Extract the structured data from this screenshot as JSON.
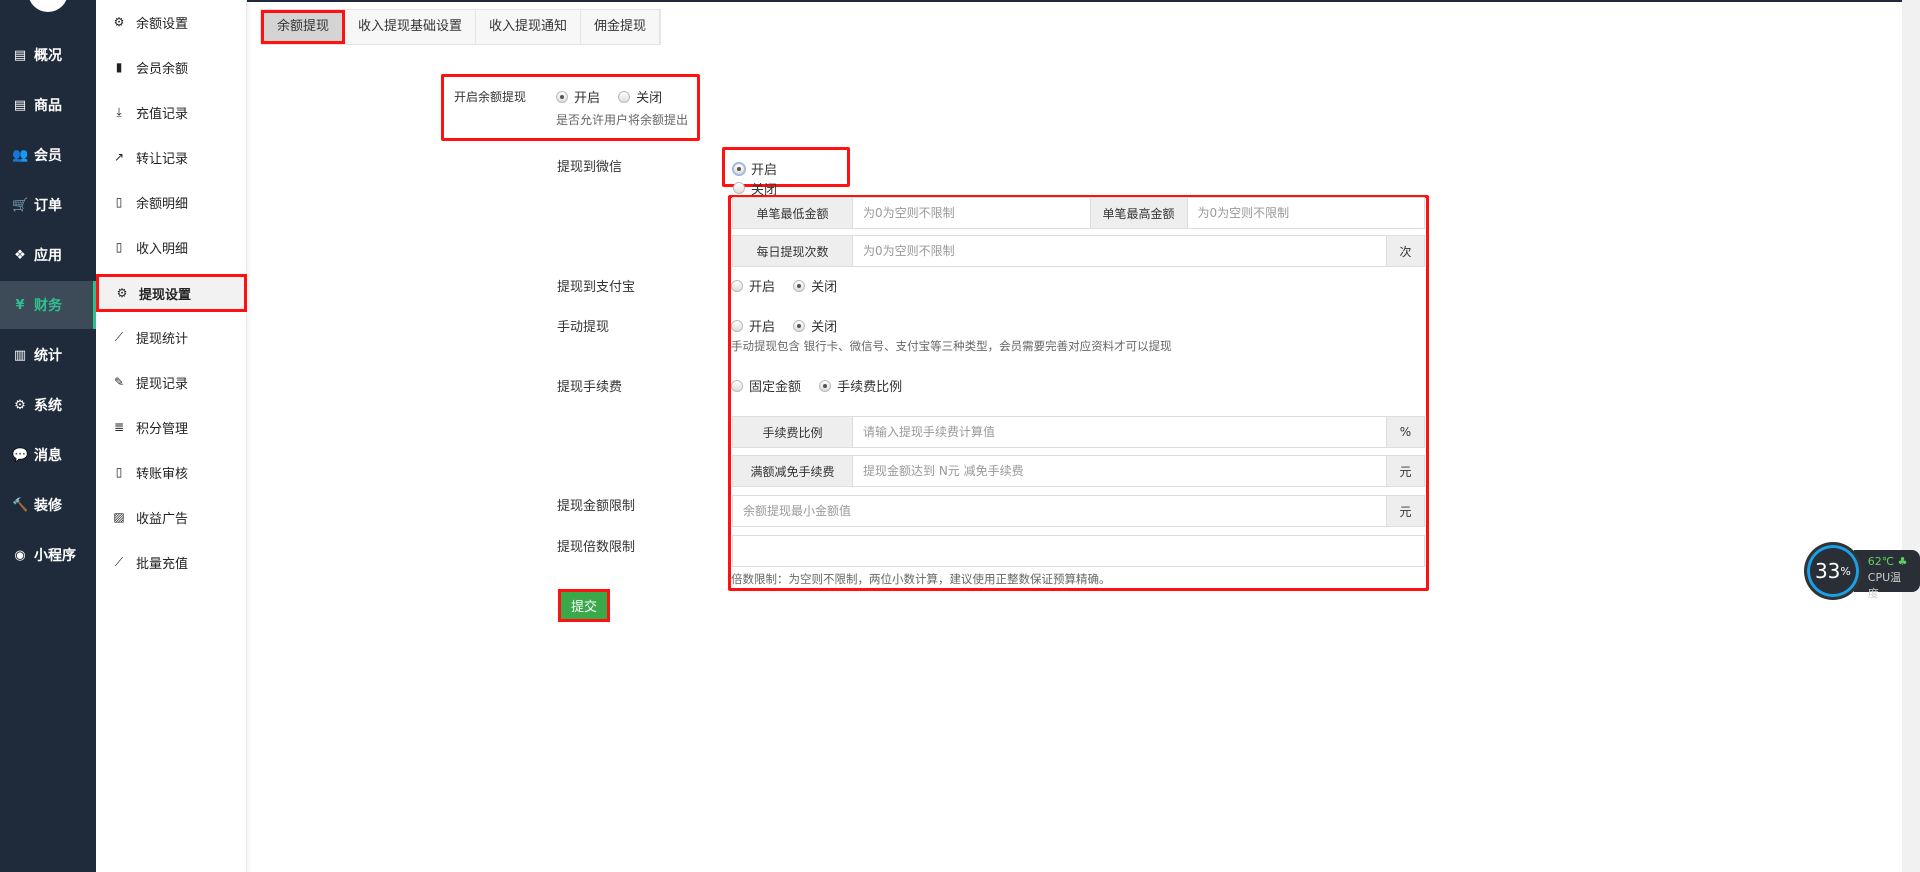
{
  "sidebar": {
    "items": [
      {
        "label": "概况",
        "icon": "archive-icon",
        "glyph": "▤"
      },
      {
        "label": "商品",
        "icon": "archive-icon",
        "glyph": "▤"
      },
      {
        "label": "会员",
        "icon": "users-icon",
        "glyph": "👥"
      },
      {
        "label": "订单",
        "icon": "cart-icon",
        "glyph": "🛒"
      },
      {
        "label": "应用",
        "icon": "cubes-icon",
        "glyph": "❖"
      },
      {
        "label": "财务",
        "icon": "yen-icon",
        "glyph": "¥"
      },
      {
        "label": "统计",
        "icon": "bar-chart-icon",
        "glyph": "▥"
      },
      {
        "label": "系统",
        "icon": "gears-icon",
        "glyph": "⚙"
      },
      {
        "label": "消息",
        "icon": "comment-icon",
        "glyph": "💬"
      },
      {
        "label": "装修",
        "icon": "gavel-icon",
        "glyph": "🔨"
      },
      {
        "label": "小程序",
        "icon": "wechat-icon",
        "glyph": "◉"
      }
    ]
  },
  "submenu": {
    "items": [
      {
        "label": "余额设置",
        "glyph": "⚙"
      },
      {
        "label": "会员余额",
        "glyph": "▮"
      },
      {
        "label": "充值记录",
        "glyph": "⤓"
      },
      {
        "label": "转让记录",
        "glyph": "↗"
      },
      {
        "label": "余额明细",
        "glyph": "▯"
      },
      {
        "label": "收入明细",
        "glyph": "▯"
      },
      {
        "label": "提现设置",
        "glyph": "⚙"
      },
      {
        "label": "提现统计",
        "glyph": "⟋"
      },
      {
        "label": "提现记录",
        "glyph": "✎"
      },
      {
        "label": "积分管理",
        "glyph": "≣"
      },
      {
        "label": "转账审核",
        "glyph": "▯"
      },
      {
        "label": "收益广告",
        "glyph": "▨"
      },
      {
        "label": "批量充值",
        "glyph": "⟋"
      }
    ]
  },
  "tabs": [
    "余额提现",
    "收入提现基础设置",
    "收入提现通知",
    "佣金提现"
  ],
  "form": {
    "enable": {
      "label": "开启余额提现",
      "on": "开启",
      "off": "关闭",
      "help": "是否允许用户将余额提出"
    },
    "wechat": {
      "label": "提现到微信",
      "on": "开启",
      "off": "关闭"
    },
    "min_amount": {
      "label": "单笔最低金额",
      "placeholder": "为0为空则不限制"
    },
    "max_amount": {
      "label": "单笔最高金额",
      "placeholder": "为0为空则不限制"
    },
    "daily": {
      "label": "每日提现次数",
      "placeholder": "为0为空则不限制",
      "unit": "次"
    },
    "alipay": {
      "label": "提现到支付宝",
      "on": "开启",
      "off": "关闭"
    },
    "manual": {
      "label": "手动提现",
      "on": "开启",
      "off": "关闭",
      "help": "手动提现包含 银行卡、微信号、支付宝等三种类型，会员需要完善对应资料才可以提现"
    },
    "fee": {
      "label": "提现手续费",
      "opt1": "固定金额",
      "opt2": "手续费比例"
    },
    "fee_rate": {
      "label": "手续费比例",
      "placeholder": "请输入提现手续费计算值",
      "unit": "%"
    },
    "fee_free": {
      "label": "满额减免手续费",
      "placeholder": "提现金额达到 N元 减免手续费",
      "unit": "元"
    },
    "amount_limit": {
      "label": "提现金额限制",
      "placeholder": "余额提现最小金额值",
      "unit": "元"
    },
    "multiple_limit": {
      "label": "提现倍数限制",
      "help": "倍数限制：为空则不限制，两位小数计算，建议使用正整数保证预算精确。"
    },
    "submit": "提交"
  },
  "cpu": {
    "percent": "33",
    "percent_sign": "%",
    "temp": "62℃",
    "label": "CPU温度"
  }
}
